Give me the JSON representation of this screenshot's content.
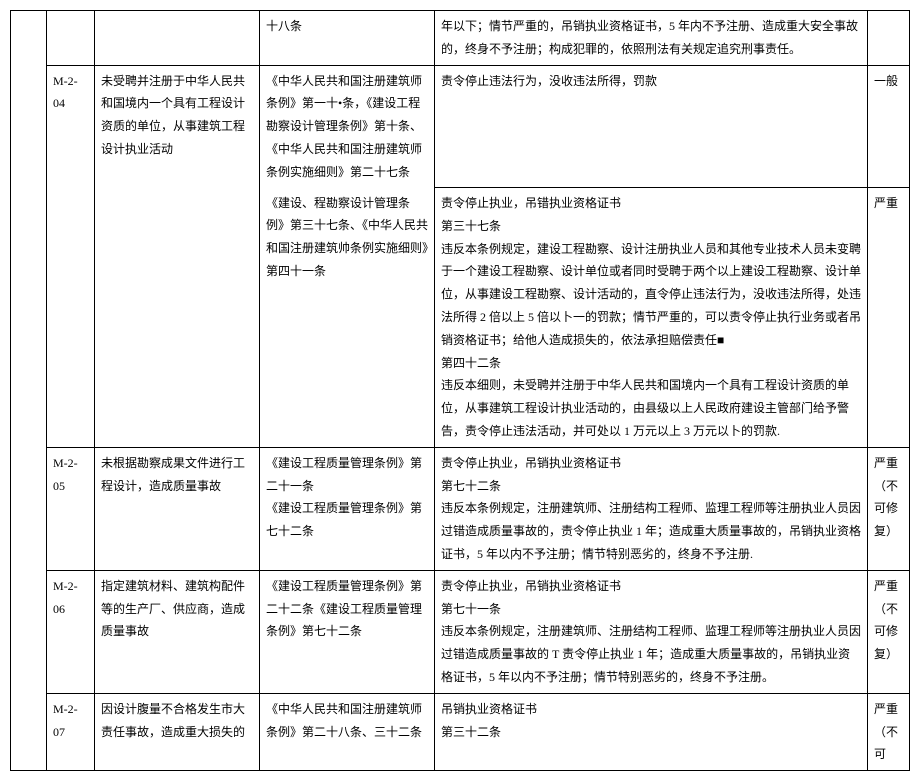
{
  "rows": [
    {
      "code": "",
      "col3": "",
      "col4": "十八条",
      "col5": "年以下；情节严重的，吊销执业资格证书，5 年内不予注册、造成重大安全事故的，终身不予注册；构成犯罪的，依照刑法有关规定追究刑事责任。",
      "col6": ""
    },
    {
      "code": "M-2-04",
      "col3": "未受聘并注册于中华人民共和国境内一个具有工程设计资质的单位，从事建筑工程设计执业活动",
      "col4": "《中华人民共和国注册建筑师条例》第一十•条，《建设工程勘察设计管理条例》第十条、《中华人民共和国注册建筑师条例实施细则》第二十七条",
      "col5a": "责令停止违法行为，没收违法所得，罚款",
      "col6a": "一般",
      "col4b": "《建设、程勘察设计管理条例》第三十七条、《中华人民共和国注册建筑帅条例实施细则》第四十一条",
      "col5b": "责令停止执业，吊错执业资格证书\n第三十七条\n违反本条例规定，建设工程勘察、设计注册执业人员和其他专业技术人员未变聘于一个建设工程勘察、设计单位或者同时受聘于两个以上建设工程勘察、设计单位，从事建设工程勘察、设计活动的，直令停止违法行为，没收违法所得，处违法所得 2 倍以上 5 倍以卜一的罚款；情节严重的，可以责令停止执行业务或者吊销资格证书；给他人造成损失的，依法承担赔偿责任■\n第四十二条\n违反本细则，未受聘并注册于中华人民共和国境内一个具有工程设计资质的单位，从事建筑工程设计执业活动的，由县级以上人民政府建设主管部门给予警告，责令停止违法活动，并可处以 1 万元以上 3 万元以卜的罚款.",
      "col6b": "严重"
    },
    {
      "code": "M-2-05",
      "col3": "未根据勘察成果文件进行工程设计，造成质量事故",
      "col4": "《建设工程质量管理条例》第二十一条\n《建设工程质量管理条例》第七十二条",
      "col5": "责令停止执业，吊销执业资格证书\n第七十二条\n违反本条例规定，注册建筑师、注册结构工程师、监理工程师等注册执业人员因过错造成质量事故的，责令停止执业 1 年；造成重大质量事故的，吊销执业资格证书，5 年以内不予注册；情节特别恶劣的，终身不予注册.",
      "col6": "严重（不可修复）"
    },
    {
      "code": "M-2-06",
      "col3": "指定建筑材料、建筑构配件等的生产厂、供应商，造成质量事故",
      "col4": "《建设工程质量管理条例》第二十二条《建设工程质量管理条例》第七十二条",
      "col5": "责令停止执业，吊销执业资格证书\n第七十一条\n违反本条例规定，注册建筑师、注册结构工程师、监理工程师等注册执业人员因过错造成质量事故的 T 责令停止执业 1 年；造成重大质量事故的，吊销执业资格证书，5 年以内不予注册；情节特别恶劣的，终身不予注册。",
      "col6": "严重（不可修复）"
    },
    {
      "code": "M-2-07",
      "col3": "因设计腹量不合格发生市大责任事故，造成重大损失的",
      "col4": "《中华人民共和国注册建筑师条例》第二十八条、三十二条",
      "col5": "吊销执业资格证书\n第三十二条",
      "col6": "严重（不可"
    }
  ]
}
